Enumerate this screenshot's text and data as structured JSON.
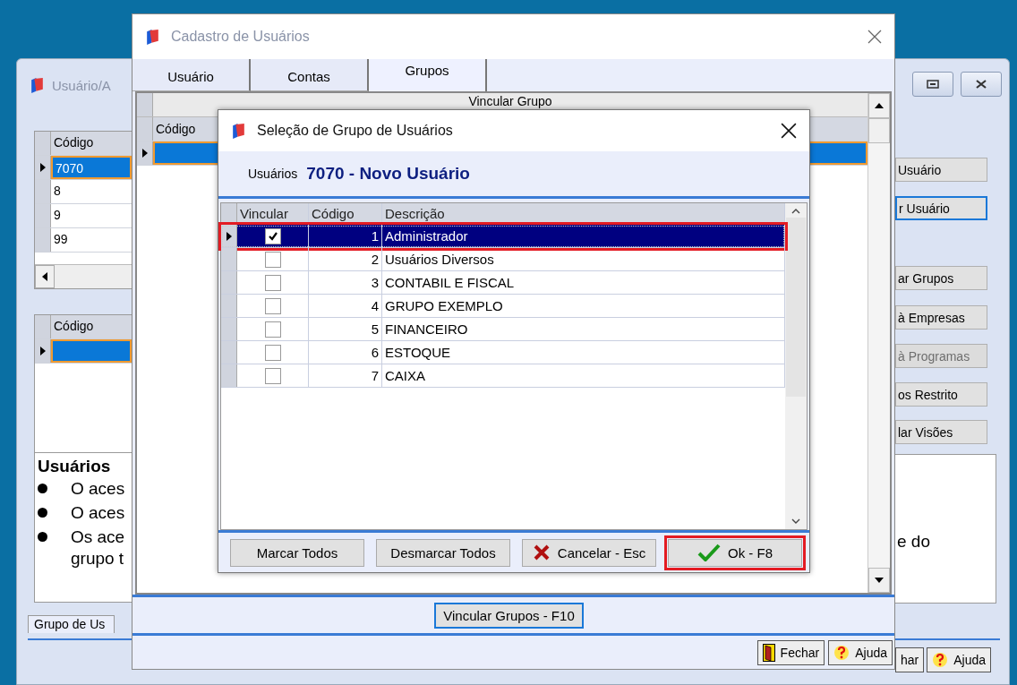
{
  "back_window": {
    "title": "Usuário/A",
    "users_grid": {
      "column": "Código",
      "rows": [
        {
          "code": "7070",
          "selected": true
        },
        {
          "code": "8",
          "selected": false
        },
        {
          "code": "9",
          "selected": false
        },
        {
          "code": "99",
          "selected": false
        }
      ]
    },
    "groups_grid": {
      "column": "Código"
    },
    "info": {
      "heading": "Usuários",
      "bullets": [
        "O aces",
        "O aces",
        "Os ace"
      ],
      "continuation": "grupo t",
      "right_fragment": "e do"
    },
    "side_buttons": [
      {
        "label": "Usuário",
        "disabled": false,
        "focused": false
      },
      {
        "label": "r Usuário",
        "disabled": false,
        "focused": true
      },
      {
        "label": "ar Grupos",
        "disabled": false,
        "focused": false
      },
      {
        "label": "à Empresas",
        "disabled": false,
        "focused": false
      },
      {
        "label": "à Programas",
        "disabled": true,
        "focused": false
      },
      {
        "label": "os Restrito",
        "disabled": false,
        "focused": false
      },
      {
        "label": "lar Visões",
        "disabled": false,
        "focused": false
      }
    ],
    "tab": "Grupo de Us",
    "footer_buttons": [
      {
        "kind": "close",
        "label": "har"
      },
      {
        "kind": "help",
        "label": "Ajuda"
      }
    ]
  },
  "main_window": {
    "title": "Cadastro de Usuários",
    "tabs": [
      {
        "label": "Usuário",
        "selected": false
      },
      {
        "label": "Contas",
        "selected": false
      },
      {
        "label": "Grupos",
        "selected": true
      }
    ],
    "grid": {
      "band": "Vincular Grupo",
      "column": "Código"
    },
    "action_button": "Vincular Grupos - F10",
    "footer_buttons": [
      {
        "kind": "close",
        "label": "Fechar"
      },
      {
        "kind": "help",
        "label": "Ajuda"
      }
    ]
  },
  "dialog": {
    "title": "Seleção de Grupo de Usuários",
    "user_label": "Usuários",
    "user_value": "7070 - Novo Usuário",
    "columns": [
      "Vincular",
      "Código",
      "Descrição"
    ],
    "rows": [
      {
        "code": "1",
        "description": "Administrador",
        "checked": true,
        "selected": true,
        "highlighted": true
      },
      {
        "code": "2",
        "description": "Usuários Diversos",
        "checked": false,
        "selected": false,
        "highlighted": false
      },
      {
        "code": "3",
        "description": "CONTABIL E FISCAL",
        "checked": false,
        "selected": false,
        "highlighted": false
      },
      {
        "code": "4",
        "description": "GRUPO EXEMPLO",
        "checked": false,
        "selected": false,
        "highlighted": false
      },
      {
        "code": "5",
        "description": "FINANCEIRO",
        "checked": false,
        "selected": false,
        "highlighted": false
      },
      {
        "code": "6",
        "description": "ESTOQUE",
        "checked": false,
        "selected": false,
        "highlighted": false
      },
      {
        "code": "7",
        "description": "CAIXA",
        "checked": false,
        "selected": false,
        "highlighted": false
      }
    ],
    "buttons": [
      {
        "kind": "plain",
        "label": "Marcar Todos",
        "highlighted": false
      },
      {
        "kind": "plain",
        "label": "Desmarcar Todos",
        "highlighted": false
      },
      {
        "kind": "cancel",
        "label": "Cancelar - Esc",
        "highlighted": false
      },
      {
        "kind": "ok",
        "label": "Ok - F8",
        "highlighted": true
      }
    ]
  }
}
